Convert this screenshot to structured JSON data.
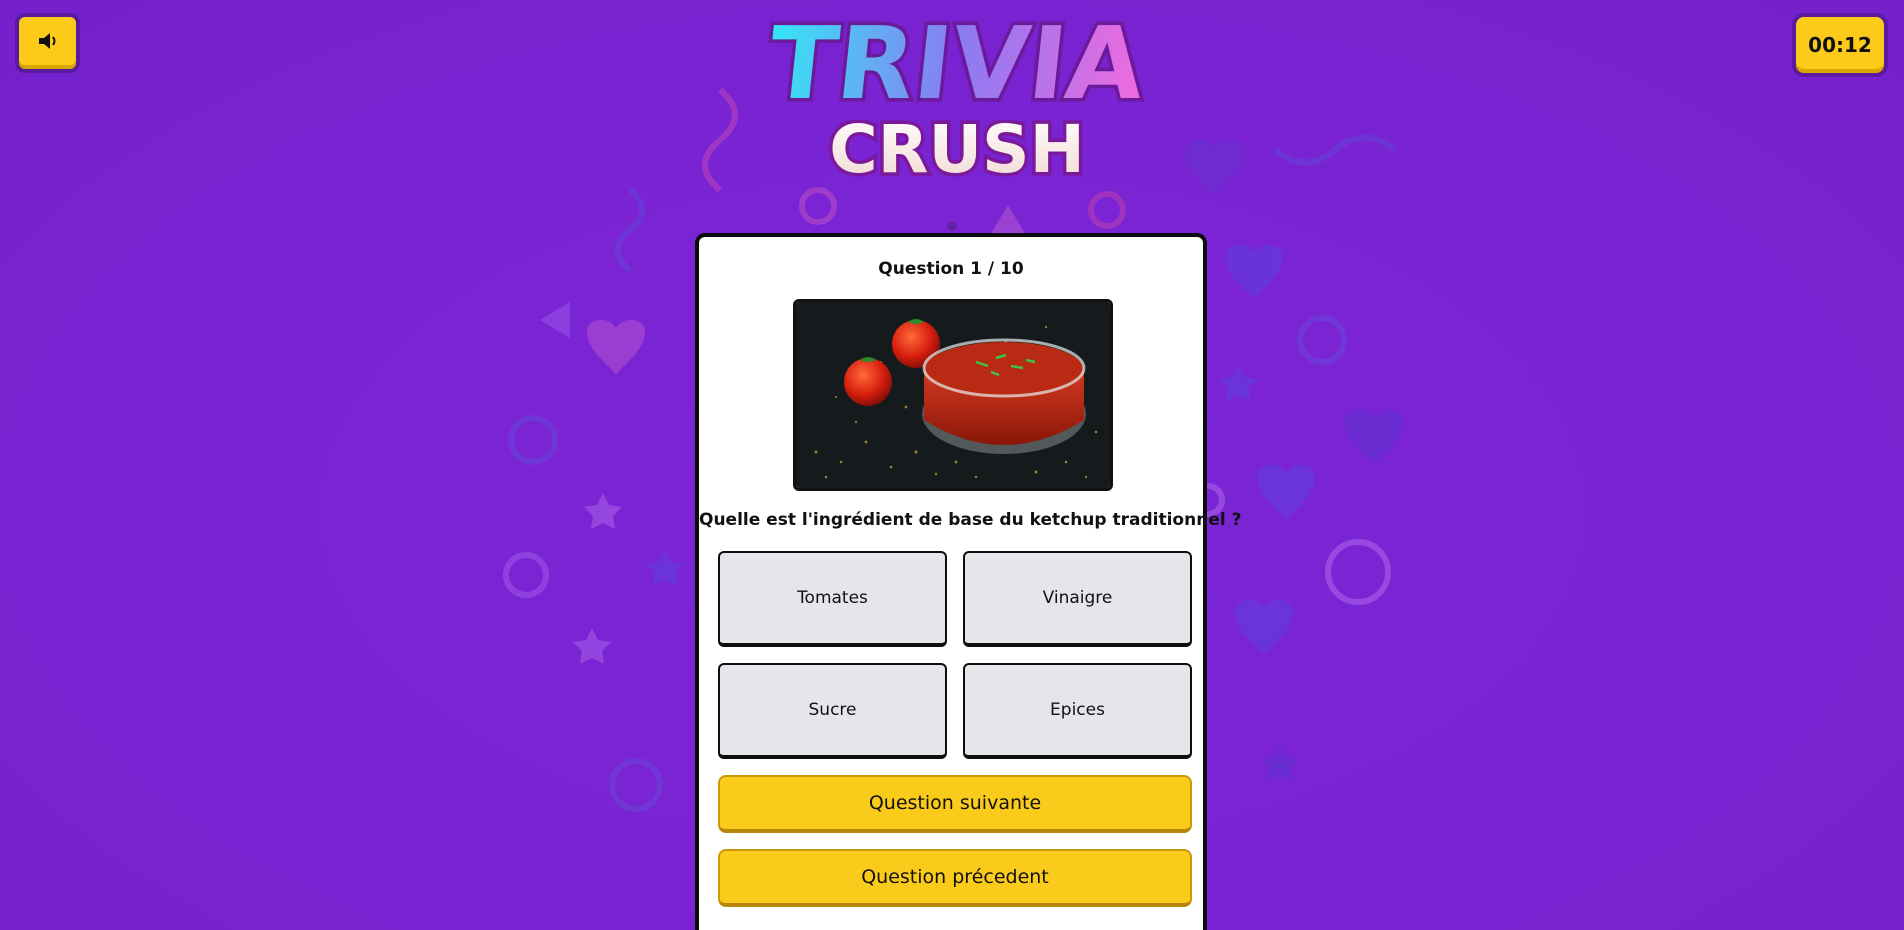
{
  "header": {
    "sound_icon": "speaker-icon",
    "timer": "00:12",
    "logo_line1": "TRIVIA",
    "logo_line2": "CRUSH"
  },
  "quiz": {
    "counter": "Question 1 / 10",
    "image_subject": "ketchup-with-tomatoes-photo",
    "question": "Quelle est l'ingrédient de base du ketchup traditionnel ?",
    "answers": [
      "Tomates",
      "Vinaigre",
      "Sucre",
      "Epices"
    ],
    "next_label": "Question suivante",
    "prev_label": "Question précedent"
  },
  "colors": {
    "background": "#7a24d4",
    "accent_yellow": "#fccb1a",
    "answer_bg": "#e5e6ea"
  }
}
